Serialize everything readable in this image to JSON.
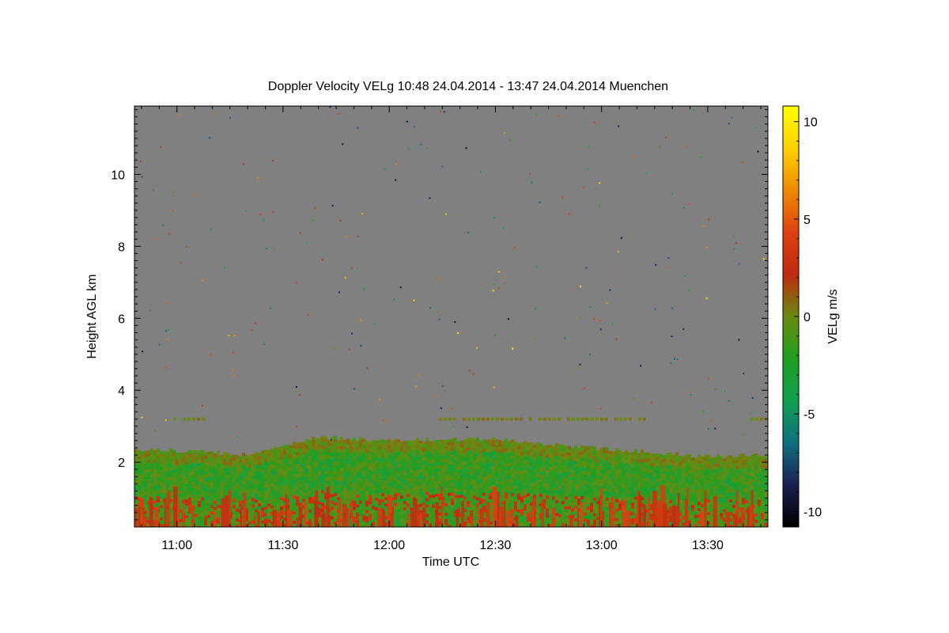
{
  "chart_data": {
    "type": "heatmap",
    "title": "Doppler Velocity VELg   10:48 24.04.2014 - 13:47 24.04.2014 Muenchen",
    "xlabel": "Time UTC",
    "ylabel": "Height AGL km",
    "x_range": [
      "10:48",
      "13:47"
    ],
    "x_ticks": [
      "11:00",
      "11:30",
      "12:00",
      "12:30",
      "13:00",
      "13:30"
    ],
    "y_range": [
      0.2,
      11.9
    ],
    "y_ticks": [
      2,
      4,
      6,
      8,
      10
    ],
    "colorbar": {
      "label": "VELg m/s",
      "range": [
        -10.8,
        10.8
      ],
      "ticks": [
        10,
        5,
        0,
        -5,
        -10
      ],
      "colors": [
        "#000000",
        "#1a2050",
        "#107080",
        "#10a050",
        "#20a020",
        "#6a8a10",
        "#c02a10",
        "#e04010",
        "#f08a00",
        "#ffd000",
        "#ffff00"
      ]
    },
    "background_color": "#808080",
    "aerosol_layer_top_km": [
      {
        "time": "10:48",
        "height": 2.35
      },
      {
        "time": "11:05",
        "height": 2.3
      },
      {
        "time": "11:20",
        "height": 2.2
      },
      {
        "time": "11:30",
        "height": 2.45
      },
      {
        "time": "11:40",
        "height": 2.7
      },
      {
        "time": "12:00",
        "height": 2.6
      },
      {
        "time": "12:30",
        "height": 2.65
      },
      {
        "time": "12:50",
        "height": 2.45
      },
      {
        "time": "13:10",
        "height": 2.3
      },
      {
        "time": "13:30",
        "height": 2.15
      },
      {
        "time": "13:47",
        "height": 2.2
      }
    ],
    "cloud_band": {
      "height_km": 3.2,
      "segments": [
        [
          "10:59",
          "11:08"
        ],
        [
          "12:14",
          "13:12"
        ],
        [
          "13:42",
          "13:47"
        ]
      ]
    }
  }
}
